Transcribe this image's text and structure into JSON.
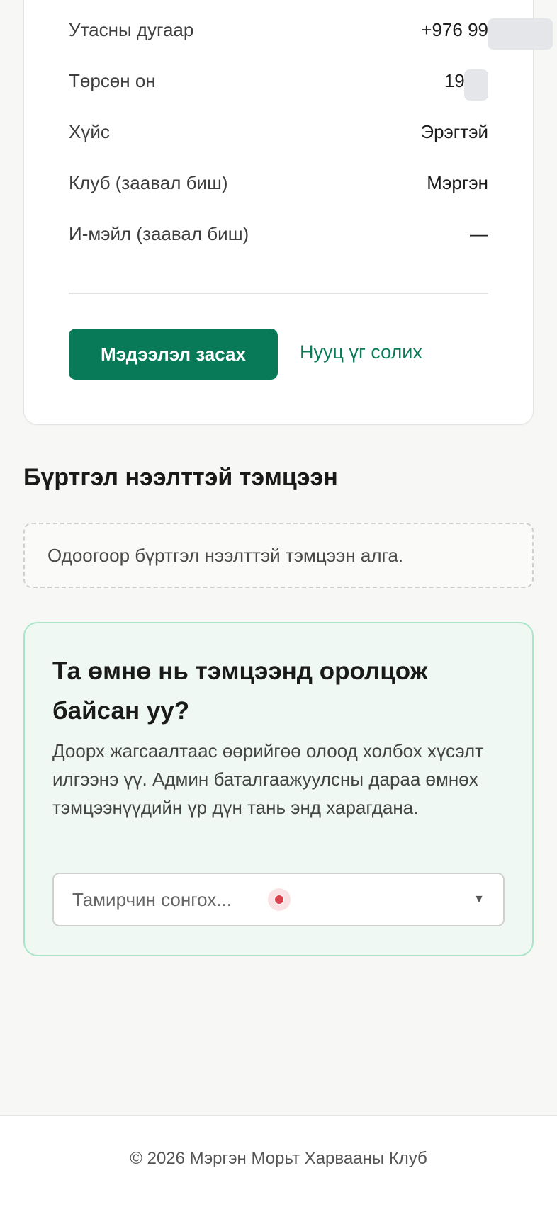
{
  "profile": {
    "rows": [
      {
        "label": "Утасны дугаар",
        "value": "+976 99"
      },
      {
        "label": "Төрсөн он",
        "value": "19"
      },
      {
        "label": "Хүйс",
        "value": "Эрэгтэй"
      },
      {
        "label": "Клуб (заавал биш)",
        "value": "Мэргэн"
      },
      {
        "label": "И-мэйл (заавал биш)",
        "value": "—"
      }
    ],
    "edit_button": "Мэдээлэл засах",
    "change_password_link": "Нууц үг солих"
  },
  "registered": {
    "title": "Бүртгэл нээлттэй тэмцээн",
    "empty_message": "Одоогоор бүртгэл нээлттэй тэмцээн алга."
  },
  "claim": {
    "title": "Та өмнө нь тэмцээнд оролцож байсан уу?",
    "description": "Доорх жагсаалтаас өөрийгөө олоод холбох хүсэлт илгээнэ үү. Админ баталгаажуулсны дараа өмнөх тэмцээнүүдийн үр дүн тань энд харагдана.",
    "select_placeholder": "Тамирчин сонгох..."
  },
  "footer": {
    "copyright": "© 2026 Мэргэн Морьт Харвааны Клуб"
  },
  "colors": {
    "primary": "#087a57",
    "claim_bg": "#eff8f3",
    "claim_border": "#a9e6c9"
  }
}
